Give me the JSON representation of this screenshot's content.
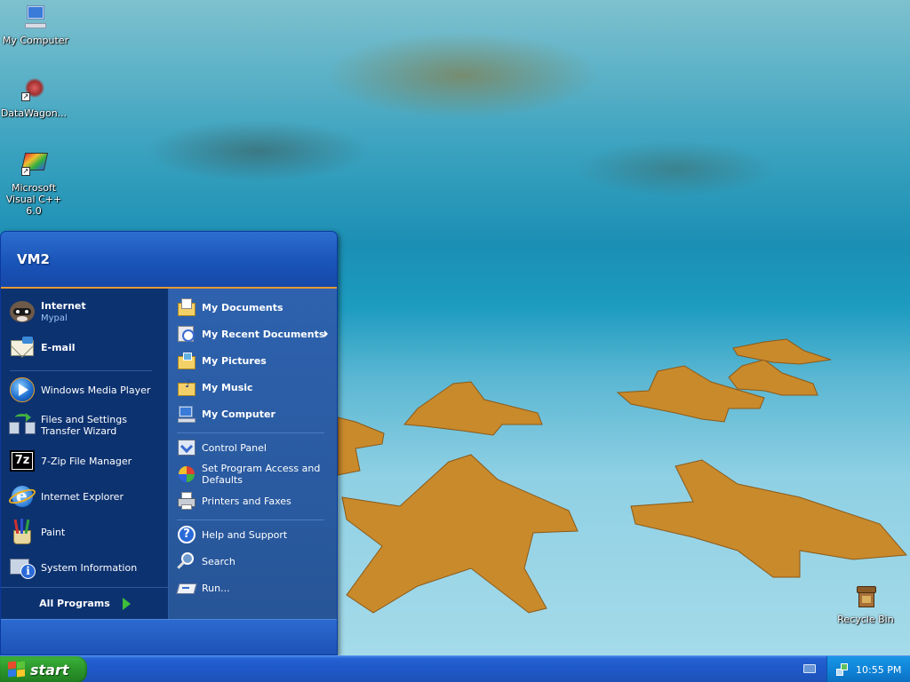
{
  "desktop": {
    "icons": [
      {
        "label": "My Computer"
      },
      {
        "label": "DataWagon..."
      },
      {
        "label": "Microsoft Visual C++ 6.0"
      },
      {
        "label": "Recycle Bin"
      }
    ]
  },
  "start_menu": {
    "user_name": "VM2",
    "pinned": [
      {
        "label": "Internet",
        "sub": "Mypal"
      },
      {
        "label": "E-mail"
      }
    ],
    "recent": [
      {
        "label": "Windows Media Player"
      },
      {
        "label": "Files and Settings Transfer Wizard"
      },
      {
        "label": "7-Zip File Manager"
      },
      {
        "label": "Internet Explorer"
      },
      {
        "label": "Paint"
      },
      {
        "label": "System Information"
      }
    ],
    "all_programs": "All Programs",
    "places": [
      {
        "label": "My Documents"
      },
      {
        "label": "My Recent Documents"
      },
      {
        "label": "My Pictures"
      },
      {
        "label": "My Music"
      },
      {
        "label": "My Computer"
      }
    ],
    "settings": [
      {
        "label": "Control Panel"
      },
      {
        "label": "Set Program Access and Defaults"
      },
      {
        "label": "Printers and Faxes"
      }
    ],
    "help": [
      {
        "label": "Help and Support"
      },
      {
        "label": "Search"
      },
      {
        "label": "Run..."
      }
    ]
  },
  "taskbar": {
    "start_label": "start",
    "clock": "10:55 PM"
  }
}
